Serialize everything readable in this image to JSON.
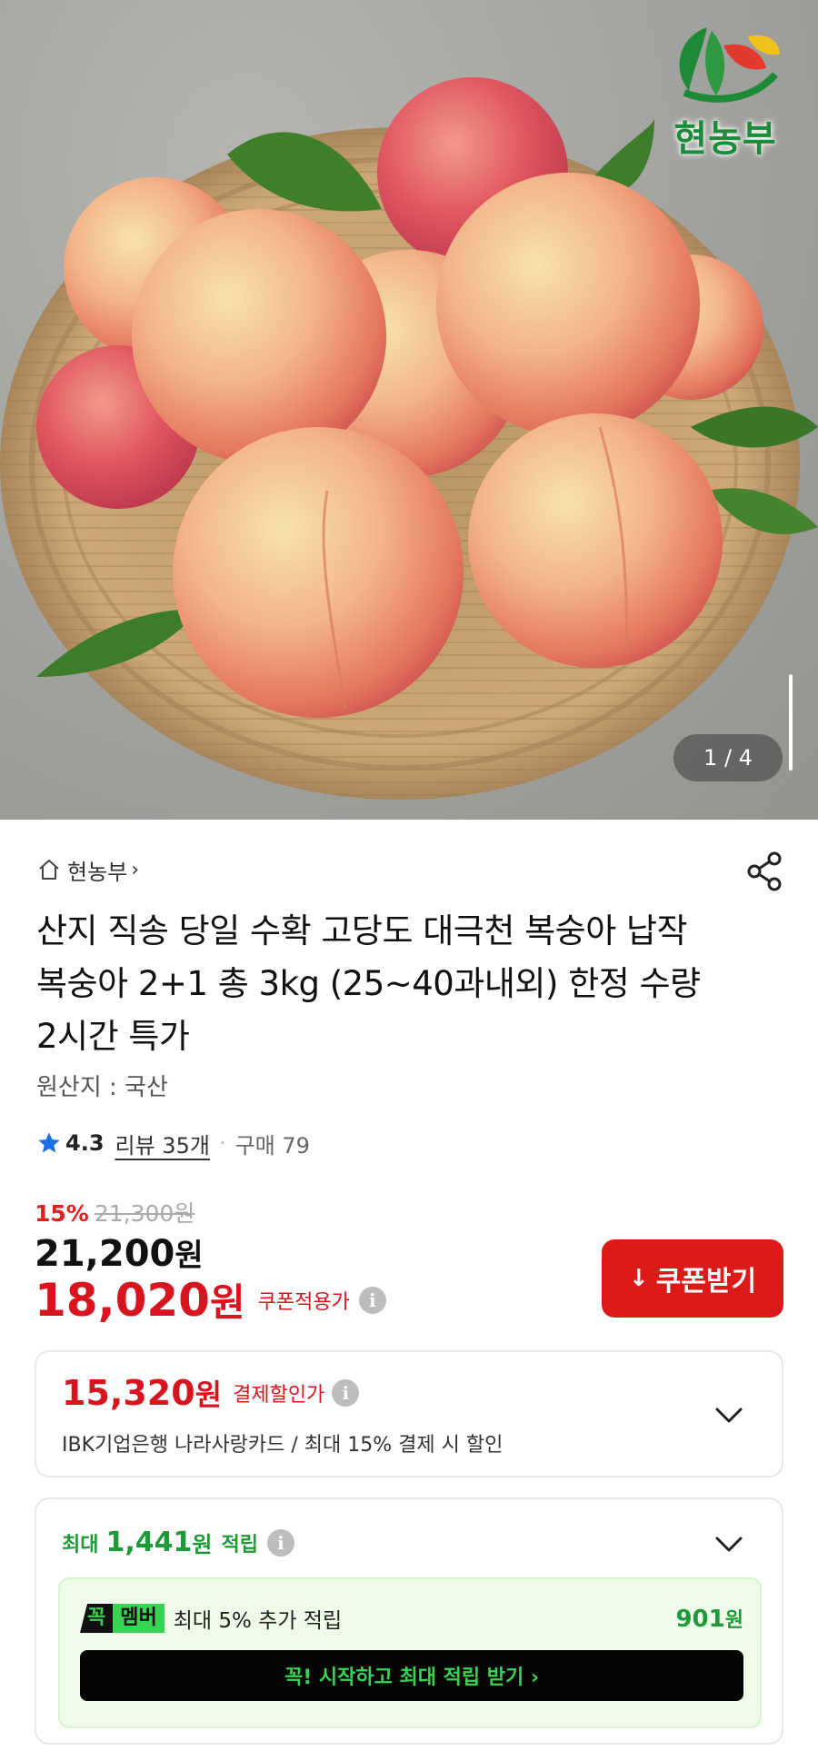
{
  "hero": {
    "brand_logo_text": "현농부",
    "pager": "1 / 4"
  },
  "store": {
    "name": "현농부",
    "chevron": "›"
  },
  "product": {
    "title": "산지 직송 당일 수확 고당도 대극천 복숭아 납작 복숭아 2+1 총 3kg (25~40과내외) 한정 수량 2시간 특가",
    "origin": "원산지 : 국산",
    "rating": "4.3",
    "reviews": "리뷰 35개",
    "separator": "·",
    "purchases": "구매 79"
  },
  "pricing": {
    "discount_rate": "15%",
    "original_price": "21,300원",
    "price": "21,200",
    "price_unit": "원",
    "coupon_price": "18,020",
    "coupon_price_unit": "원",
    "coupon_price_label": "쿠폰적용가",
    "coupon_button_icon": "↓",
    "coupon_button_label": "쿠폰받기"
  },
  "payment_discount": {
    "amount": "15,320",
    "unit": "원",
    "label": "결제할인가",
    "description": "IBK기업은행 나라사랑카드 / 최대 15% 결제 시 할인"
  },
  "points": {
    "prefix": "최대",
    "amount": "1,441",
    "unit": "원",
    "suffix": "적립",
    "member_badge_1": "꼭",
    "member_badge_2": "멤버",
    "member_text": "최대 5% 추가 적립",
    "member_bonus": "901",
    "member_bonus_unit": "원",
    "start_button": "꼭! 시작하고 최대 적립 받기 ›"
  },
  "info_icon": "i",
  "colors": {
    "accent_red": "#d8141e",
    "button_red": "#dc1a1a",
    "point_green": "#1f9a39",
    "badge_green": "#39d353"
  },
  "icons": [
    "house-icon",
    "share-icon",
    "star-icon",
    "info-icon",
    "download-icon",
    "chevron-down-icon"
  ]
}
